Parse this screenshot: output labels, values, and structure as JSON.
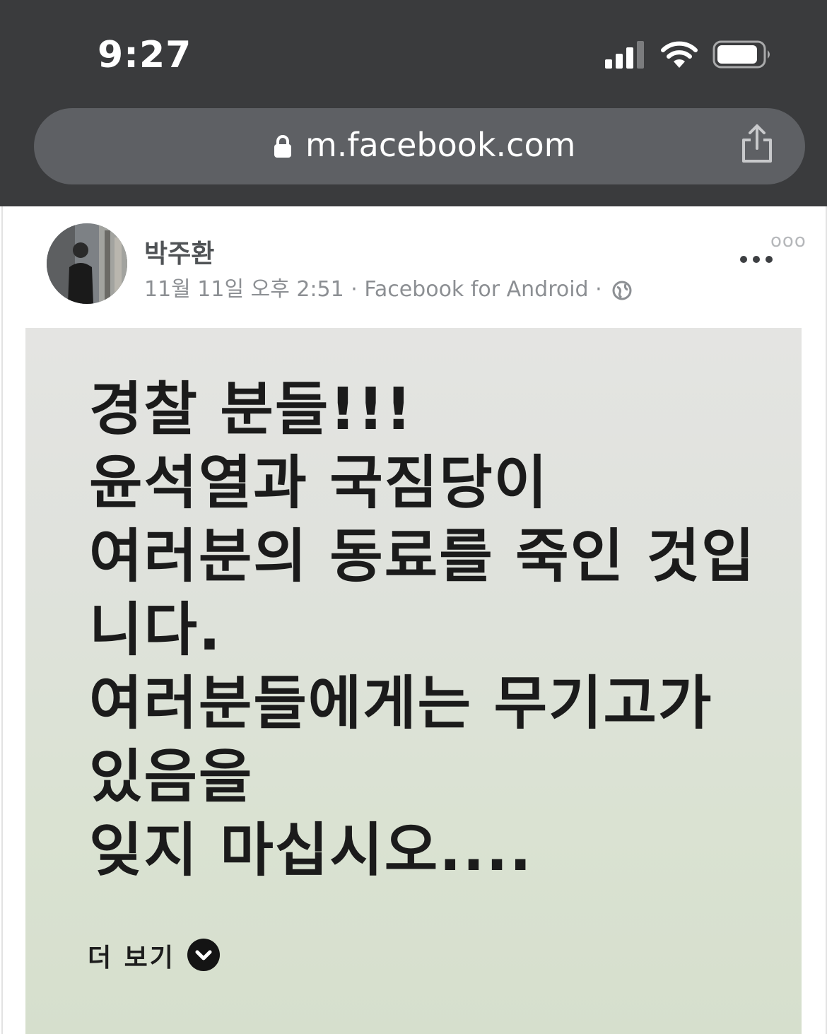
{
  "status_bar": {
    "time": "9:27",
    "signal_icon": "cellular-signal-icon",
    "wifi_icon": "wifi-icon",
    "battery_icon": "battery-icon"
  },
  "browser": {
    "url": "m.facebook.com",
    "lock_icon": "lock-icon",
    "share_icon": "share-icon"
  },
  "post": {
    "author": "박주환",
    "meta": "11월 11일 오후 2:51 · Facebook for Android ·",
    "more_icon": "more-options-icon",
    "corner_mark": "ooo",
    "lines": [
      "경찰 분들!!!",
      "윤석열과 국짐당이",
      "여러분의 동료를 죽인 것입",
      "니다.",
      "여러분들에게는 무기고가",
      "있음을",
      "잊지 마십시오...."
    ],
    "see_more_label": "더 보기"
  },
  "colors": {
    "chrome_bg": "#3a3b3d",
    "url_bar_bg": "#5e6064",
    "text_card_top": "#e4e4e2",
    "text_card_bottom": "#d6dfcd",
    "post_text": "#1b1b1b",
    "meta_text": "#8c8f93"
  }
}
